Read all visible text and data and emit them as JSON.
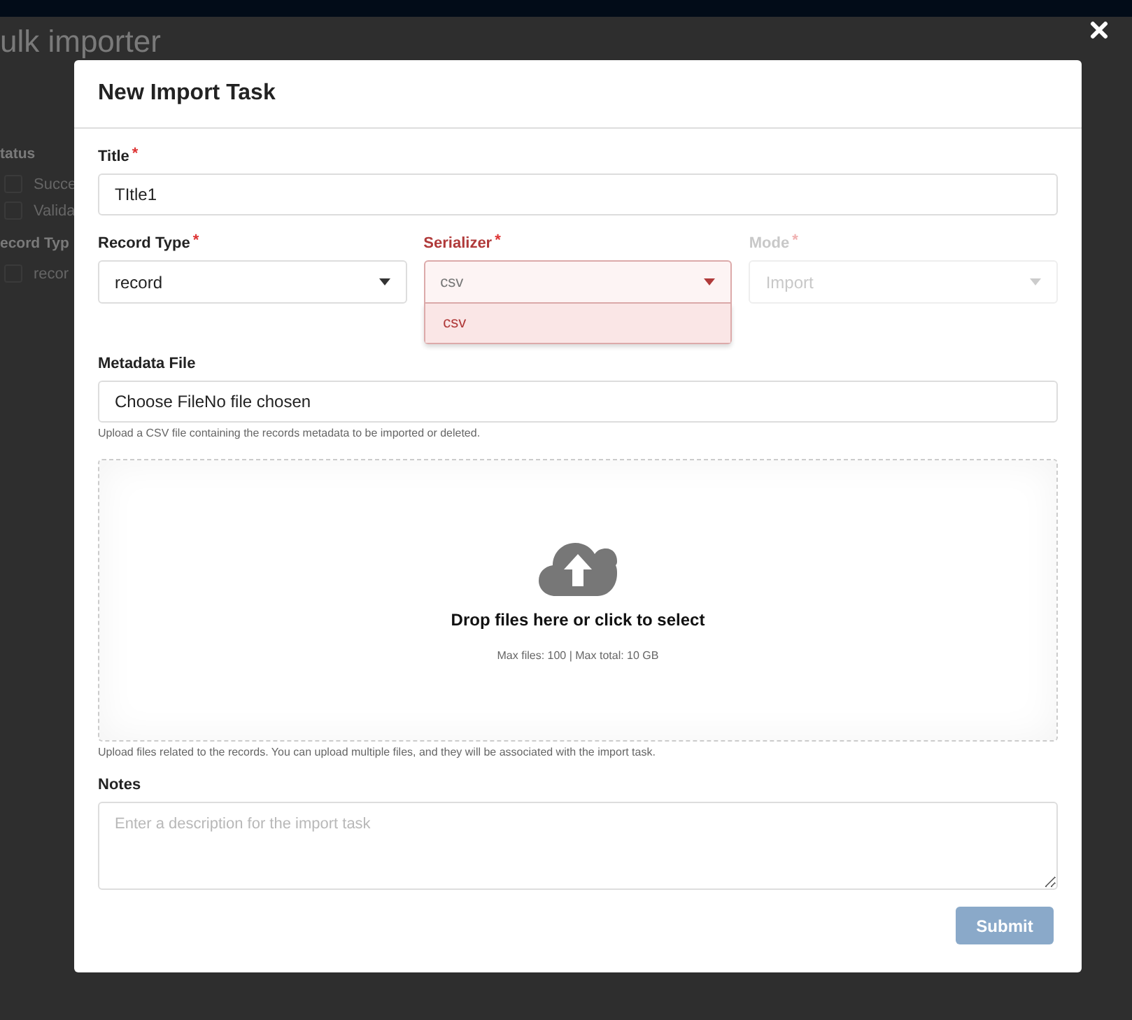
{
  "page": {
    "title": "ulk importer",
    "filters": [
      {
        "heading": "tatus",
        "options": [
          {
            "label": "Succe",
            "checked": false
          },
          {
            "label": "Valida",
            "checked": false
          }
        ]
      },
      {
        "heading": "ecord Typ",
        "options": [
          {
            "label": "recor",
            "checked": false
          }
        ]
      }
    ]
  },
  "modal": {
    "title": "New Import Task",
    "title_field": {
      "label": "Title",
      "required_mark": "*",
      "value": "TItle1"
    },
    "selects": [
      {
        "label": "Record Type",
        "required_mark": "*",
        "value": "record",
        "disabled": false,
        "open": false
      },
      {
        "label": "Serializer",
        "required_mark": "*",
        "value": "csv",
        "disabled": false,
        "open": true,
        "options": [
          {
            "label": "csv",
            "selected": true
          }
        ]
      },
      {
        "label": "Mode",
        "required_mark": "*",
        "value": "Import",
        "disabled": true,
        "open": false
      }
    ],
    "metadata_file": {
      "label": "Metadata File",
      "value": "Choose FileNo file chosen",
      "help": "Upload a CSV file containing the records metadata to be imported or deleted."
    },
    "dropzone": {
      "prompt": "Drop files here or click to select",
      "limits": "Max files: 100 | Max total: 10 GB",
      "help": "Upload files related to the records. You can upload multiple files, and they will be associated with the import task."
    },
    "notes": {
      "label": "Notes",
      "placeholder": "Enter a description for the import task"
    },
    "submit": {
      "label": "Submit",
      "disabled": true
    }
  }
}
